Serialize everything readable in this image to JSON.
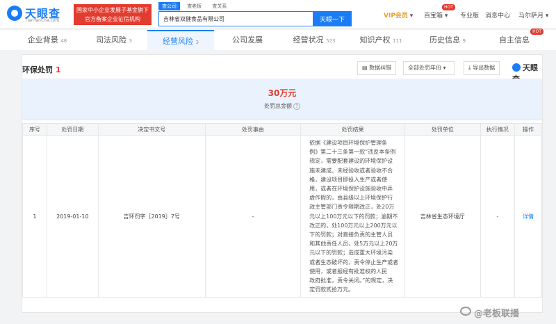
{
  "header": {
    "logo_text": "天眼查",
    "logo_url": "TianYanCha.com",
    "ad_line1": "国家中小企业发展子基金旗下",
    "ad_line2": "官方备案企业征信机构",
    "search_tabs": [
      "查公司",
      "查老板",
      "查关系"
    ],
    "search_value": "吉林省双健食品有限公司",
    "search_button": "天眼一下",
    "vip_label": "VIP会员",
    "nav": [
      "百宝箱",
      "专业版",
      "消息中心",
      "马尔萨月"
    ],
    "hot_badge": "HOT"
  },
  "tabs": [
    {
      "label": "企业背景",
      "count": "48"
    },
    {
      "label": "司法风险",
      "count": "3"
    },
    {
      "label": "经营风险",
      "count": "3"
    },
    {
      "label": "公司发展",
      "count": ""
    },
    {
      "label": "经营状况",
      "count": "523"
    },
    {
      "label": "知识产权",
      "count": "111"
    },
    {
      "label": "历史信息",
      "count": "9"
    },
    {
      "label": "自主信息",
      "count": ""
    }
  ],
  "section": {
    "title": "环保处罚",
    "count": "1",
    "btn_compare": "数据纠错",
    "btn_year": "全部处罚年份",
    "btn_export": "导出数据",
    "brand": "天眼查"
  },
  "summary": {
    "amount": "30万元",
    "label": "处罚总金额",
    "q": "?"
  },
  "table": {
    "headers": [
      "序号",
      "处罚日期",
      "决定书文号",
      "处罚事由",
      "处罚结果",
      "处罚单位",
      "执行情况",
      "操作"
    ],
    "row": {
      "index": "1",
      "date": "2019-01-10",
      "doc_no": "吉环罚字［2019］7号",
      "reason": "-",
      "result_lines": [
        "依据《建设项目环境保护管理条",
        "例》第二十三条第一款“违反本条例",
        "规定，需要配套建设的环境保护设",
        "施未建成、未经验收或者验收不合",
        "格，建设项目即投入生产或者使",
        "用，或者在环境保护设施验收中弄",
        "虚作假的，由县级以上环境保护行",
        "政主管部门责令限期改正，处20万",
        "元以上100万元以下的罚款；逾期不",
        "改正的，处100万元以上200万元以",
        "下的罚款；对直接负责的主管人员",
        "和其他责任人员，处5万元以上20万",
        "元以下的罚款；造成重大环境污染",
        "或者生态破坏的，责令停止生产或者",
        "使用，或者报经有批准权的人民",
        "政府批准，责令关闭。”的规定，决",
        "定罚款贰拾万元。"
      ],
      "unit": "吉林省生态环境厅",
      "status": "-",
      "action": "详情"
    }
  },
  "watermark": "@老板联播"
}
